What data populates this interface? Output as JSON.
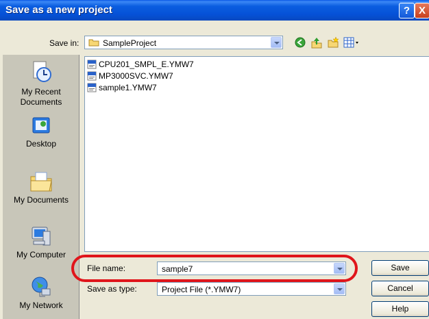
{
  "window": {
    "title": "Save as a new project",
    "help_label": "?",
    "close_label": "X"
  },
  "toolbar": {
    "save_in_label": "Save in:",
    "save_in_value": "SampleProject",
    "icons": [
      "back-icon",
      "up-folder-icon",
      "new-folder-icon",
      "views-icon"
    ]
  },
  "places": [
    {
      "label": "My Recent Documents",
      "icon": "recent-documents-icon"
    },
    {
      "label": "Desktop",
      "icon": "desktop-icon"
    },
    {
      "label": "My Documents",
      "icon": "my-documents-icon"
    },
    {
      "label": "My Computer",
      "icon": "my-computer-icon"
    },
    {
      "label": "My Network",
      "icon": "my-network-icon"
    }
  ],
  "files": [
    {
      "name": "CPU201_SMPL_E.YMW7",
      "icon_badge": "MPE"
    },
    {
      "name": "MP3000SVC.YMW7",
      "icon_badge": "MPE"
    },
    {
      "name": "sample1.YMW7",
      "icon_badge": "MPE"
    }
  ],
  "form": {
    "file_name_label": "File name:",
    "file_name_value": "sample7",
    "save_as_type_label": "Save as type:",
    "save_as_type_value": "Project File (*.YMW7)"
  },
  "buttons": {
    "save": "Save",
    "cancel": "Cancel",
    "help": "Help"
  },
  "colors": {
    "titlebar": "#0551d7",
    "highlight": "#e0151b",
    "places_bg": "#c8c6b9"
  }
}
